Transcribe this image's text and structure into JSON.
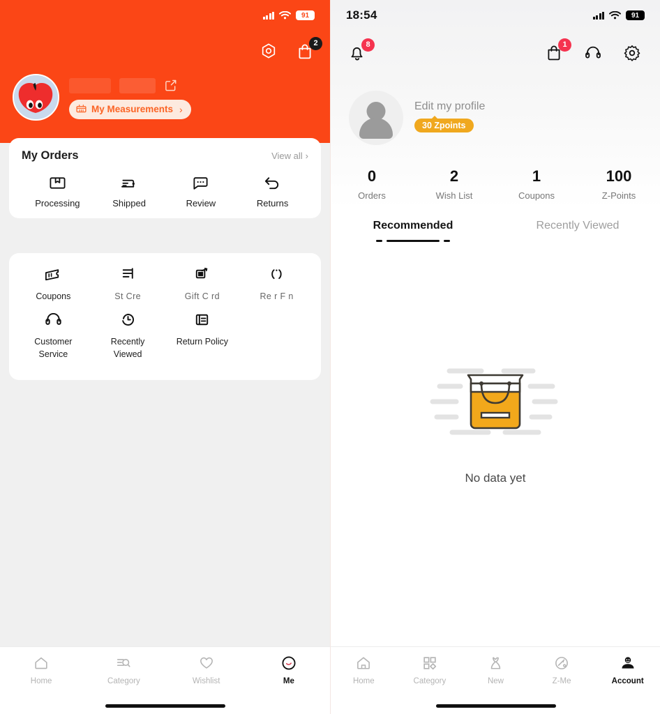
{
  "left_screen": {
    "theme_color": "#fb4616",
    "status_bar": {
      "time": "",
      "battery": "91",
      "signal_icon": "cellular-signal-icon",
      "wifi_icon": "wifi-icon"
    },
    "header": {
      "settings_icon": "hexagon-settings-icon",
      "bag_icon": "shopping-bag-icon",
      "bag_badge": "2"
    },
    "profile": {
      "avatar_icon": "user-avatar-apple",
      "username_placeholder": "",
      "edit_icon": "edit-pencil-icon",
      "measurements_label": "My Measurements",
      "measurements_icon": "ruler-icon",
      "chevron": "›"
    },
    "orders_card": {
      "title": "My Orders",
      "view_all": "View all",
      "chevron": "›",
      "items": [
        {
          "label": "Processing",
          "icon": "package-box-icon"
        },
        {
          "label": "Shipped",
          "icon": "shipped-truck-icon"
        },
        {
          "label": "Review",
          "icon": "comment-review-icon"
        },
        {
          "label": "Returns",
          "icon": "return-arrow-icon"
        }
      ]
    },
    "services_card": {
      "items": [
        {
          "label": "Coupons",
          "icon": "coupon-ticket-icon",
          "partial": false
        },
        {
          "label": "St  Cre  ",
          "icon": "store-credit-icon",
          "partial": true
        },
        {
          "label": "Gift C rd",
          "icon": "gift-card-icon",
          "partial": true
        },
        {
          "label": "Re  r   F  n",
          "icon": "refer-friend-icon",
          "partial": true
        },
        {
          "label": "Customer Service",
          "icon": "headset-icon",
          "partial": false
        },
        {
          "label": "Recently Viewed",
          "icon": "clock-history-icon",
          "partial": false
        },
        {
          "label": "Return Policy",
          "icon": "document-policy-icon",
          "partial": false
        }
      ]
    },
    "tabbar": {
      "items": [
        {
          "label": "Home",
          "icon": "home-icon",
          "active": false
        },
        {
          "label": "Category",
          "icon": "category-search-icon",
          "active": false
        },
        {
          "label": "Wishlist",
          "icon": "heart-icon",
          "active": false
        },
        {
          "label": "Me",
          "icon": "me-circle-icon",
          "active": true
        }
      ]
    }
  },
  "right_screen": {
    "status_bar": {
      "time": "18:54",
      "battery": "91",
      "signal_icon": "cellular-signal-icon",
      "wifi_icon": "wifi-icon"
    },
    "header": {
      "bell_icon": "notification-bell-icon",
      "bell_badge": "8",
      "bag_icon": "shopping-bag-icon",
      "bag_badge": "1",
      "headset_icon": "headset-support-icon",
      "gear_icon": "gear-settings-icon"
    },
    "profile": {
      "avatar_icon": "default-user-avatar",
      "edit_profile": "Edit my profile",
      "zpoints_badge": "30 Zpoints",
      "zpoints_color": "#f0a81e"
    },
    "stats": [
      {
        "value": "0",
        "label": "Orders"
      },
      {
        "value": "2",
        "label": "Wish List"
      },
      {
        "value": "1",
        "label": "Coupons"
      },
      {
        "value": "100",
        "label": "Z-Points"
      }
    ],
    "tabs": [
      {
        "label": "Recommended",
        "active": true
      },
      {
        "label": "Recently Viewed",
        "active": false
      }
    ],
    "empty_state": {
      "message": "No data yet",
      "illustration": "empty-shopping-bag-illustration",
      "illustration_color": "#f5a623"
    },
    "tabbar": {
      "items": [
        {
          "label": "Home",
          "icon": "home-icon",
          "active": false
        },
        {
          "label": "Category",
          "icon": "grid-category-icon",
          "active": false
        },
        {
          "label": "New",
          "icon": "dress-new-icon",
          "active": false
        },
        {
          "label": "Z-Me",
          "icon": "zme-gauge-icon",
          "active": false
        },
        {
          "label": "Account",
          "icon": "account-person-icon",
          "active": true
        }
      ]
    }
  }
}
